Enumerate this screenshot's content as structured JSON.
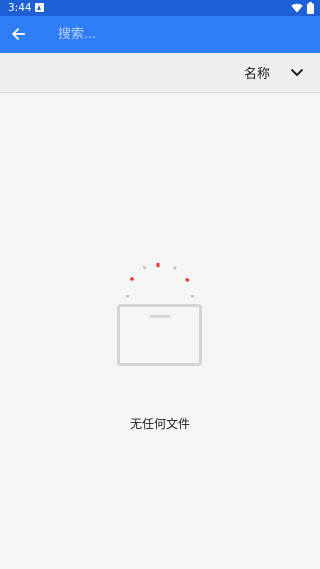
{
  "status_bar": {
    "time": "3:44",
    "icons": [
      "notification-icon",
      "wifi-icon",
      "battery-icon"
    ]
  },
  "app_bar": {
    "back_icon": "arrow-left-icon",
    "search_placeholder": "搜索..."
  },
  "sort_bar": {
    "selected": "名称",
    "dropdown_icon": "chevron-down-icon"
  },
  "empty_state": {
    "illustration": "empty-folder-icon",
    "message": "无任何文件"
  },
  "colors": {
    "status_bar": "#1f5fd6",
    "app_bar": "#2e7cf6",
    "accent_red": "#e53935",
    "illustration_gray": "#d4d4d4"
  }
}
